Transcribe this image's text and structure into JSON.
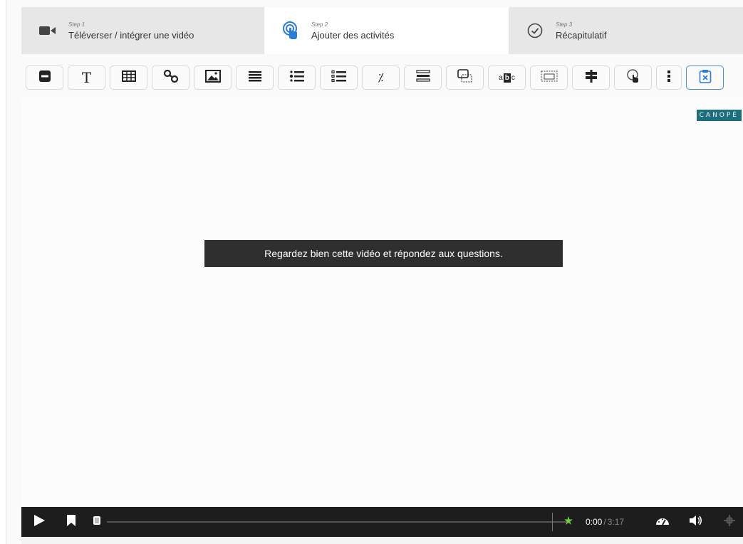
{
  "steps": [
    {
      "small": "Step 1",
      "label": "Téléverser / intégrer une vidéo",
      "icon": "video-camera-icon"
    },
    {
      "small": "Step 2",
      "label": "Ajouter des activités",
      "icon": "touch-click-icon"
    },
    {
      "small": "Step 3",
      "label": "Récapitulatif",
      "icon": "check-circle-icon"
    }
  ],
  "toolbar": {
    "buttons": [
      {
        "name": "label-button",
        "icon": "minus-box-icon"
      },
      {
        "name": "text-button",
        "icon": "text-icon",
        "glyph": "T"
      },
      {
        "name": "table-button",
        "icon": "table-icon"
      },
      {
        "name": "link-button",
        "icon": "link-icon"
      },
      {
        "name": "image-button",
        "icon": "image-icon"
      },
      {
        "name": "statements-button",
        "icon": "list-icon"
      },
      {
        "name": "single-choice-button",
        "icon": "single-choice-icon"
      },
      {
        "name": "multiple-choice-button",
        "icon": "multiple-choice-icon"
      },
      {
        "name": "true-false-button",
        "icon": "percent-icon",
        "glyph": "⁒"
      },
      {
        "name": "drag-drop-button",
        "icon": "drag-drop-icon"
      },
      {
        "name": "summary-button",
        "icon": "summary-icon"
      },
      {
        "name": "drag-text-button",
        "icon": "drag-text-icon"
      },
      {
        "name": "fill-blanks-button",
        "icon": "fill-blanks-icon"
      },
      {
        "name": "crossroads-button",
        "icon": "signpost-icon"
      },
      {
        "name": "navigation-hotspot-button",
        "icon": "hotspot-icon"
      },
      {
        "name": "more-button",
        "icon": "more-vertical-icon"
      },
      {
        "name": "free-text-button",
        "icon": "clipboard-x-icon"
      }
    ]
  },
  "video": {
    "logo_text": "CANOPÉ",
    "caption": "Regardez bien cette vidéo et répondez aux questions."
  },
  "controls": {
    "current_time": "0:00",
    "separator": "/",
    "duration": "3:17",
    "progress": 0
  },
  "colors": {
    "accent_blue": "#2b7cd3",
    "logo_bg": "#1e6f7d",
    "controls_bg": "#1d1d1d",
    "bookmark_green": "#6fcf3f"
  }
}
